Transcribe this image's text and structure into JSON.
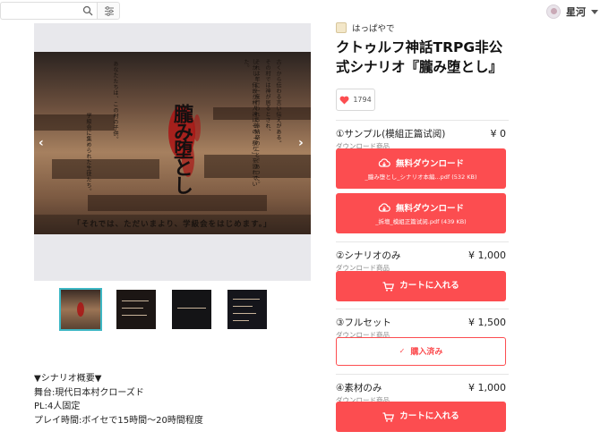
{
  "header": {
    "search_icon": "search-icon",
    "filter_icon": "filter-icon",
    "username": "星河"
  },
  "gallery": {
    "main_caption": "「それでは、ただいまより、学級会をはじめます。」",
    "title_glyphs": "朧み堕とし",
    "prev_arrow": "‹",
    "next_arrow": "›",
    "thumbnail_count": 4,
    "active_thumbnail": 1
  },
  "description": {
    "lines": [
      "▼シナリオ概要▼",
      "舞台:現代日本村クローズド",
      "PL:4人固定",
      "プレイ時間:ボイセで15時間〜20時間程度"
    ]
  },
  "product": {
    "shop_name": "はっぱやで",
    "title": "クトゥルフ神話TRPG非公式シナリオ『朧み堕とし』",
    "likes": "1794"
  },
  "items": [
    {
      "name": "①サンプル(模組正篇试阅)",
      "type": "ダウンロード商品",
      "price": "¥ 0",
      "buttons": [
        {
          "label": "無料ダウンロード",
          "file": "_朧み堕とし_シナリオ本編...pdf (532 KB)"
        },
        {
          "label": "無料ダウンロード",
          "file": "_拆壇_模組正篇试阅.pdf (439 KB)"
        }
      ]
    },
    {
      "name": "②シナリオのみ",
      "type": "ダウンロード商品",
      "price": "¥ 1,000",
      "button": "カートに入れる"
    },
    {
      "name": "③フルセット",
      "type": "ダウンロード商品",
      "price": "¥ 1,500",
      "button": "購入済み"
    },
    {
      "name": "④素材のみ",
      "type": "ダウンロード商品",
      "price": "¥ 1,000",
      "button": "カートに入れる"
    }
  ],
  "colors": {
    "accent": "#fc4d50",
    "thumb_active": "#3db7c4",
    "gallery_bg": "#e8e8ec"
  }
}
